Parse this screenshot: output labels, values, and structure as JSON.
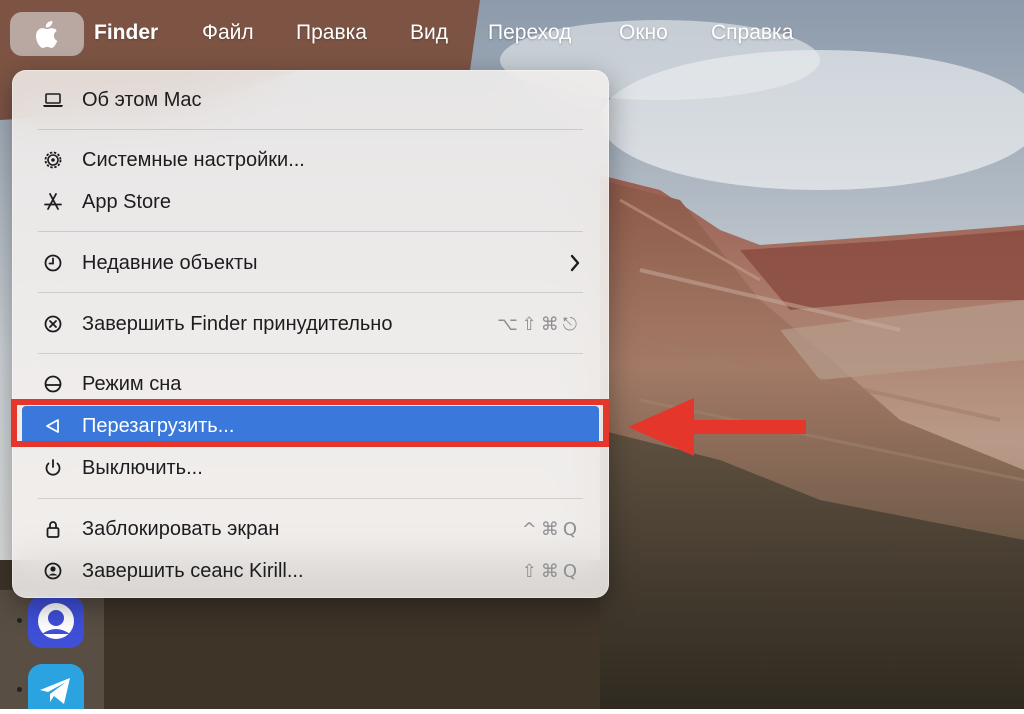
{
  "menubar": {
    "apple_icon": "apple-logo-icon",
    "app_name": "Finder",
    "items": [
      "Файл",
      "Правка",
      "Вид",
      "Переход",
      "Окно",
      "Справка"
    ]
  },
  "apple_menu": {
    "items": [
      {
        "icon": "laptop-icon",
        "label": "Об этом Mac",
        "shortcut": ""
      },
      {
        "icon": "gear-icon",
        "label": "Системные настройки...",
        "shortcut": ""
      },
      {
        "icon": "app-store-icon",
        "label": "App Store",
        "shortcut": ""
      },
      {
        "icon": "clock-icon",
        "label": "Недавние объекты",
        "shortcut": "",
        "submenu_icon": "chevron-right-icon"
      },
      {
        "icon": "force-quit-icon",
        "label": "Завершить Finder принудительно",
        "shortcut": "⌥⇧⌘⎋"
      },
      {
        "icon": "sleep-icon",
        "label": "Режим сна",
        "shortcut": ""
      },
      {
        "icon": "restart-icon",
        "label": "Перезагрузить...",
        "shortcut": "",
        "highlighted": true
      },
      {
        "icon": "power-icon",
        "label": "Выключить...",
        "shortcut": ""
      },
      {
        "icon": "lock-icon",
        "label": "Заблокировать экран",
        "shortcut": "^⌘Q"
      },
      {
        "icon": "user-icon",
        "label": "Завершить сеанс Kirill...",
        "shortcut": "⇧⌘Q"
      }
    ]
  },
  "annotation": {
    "color": "#e4362b",
    "highlight_color": "#3a78dc"
  },
  "dock": {
    "apps": [
      "contacts-app-icon",
      "telegram-app-icon"
    ]
  }
}
